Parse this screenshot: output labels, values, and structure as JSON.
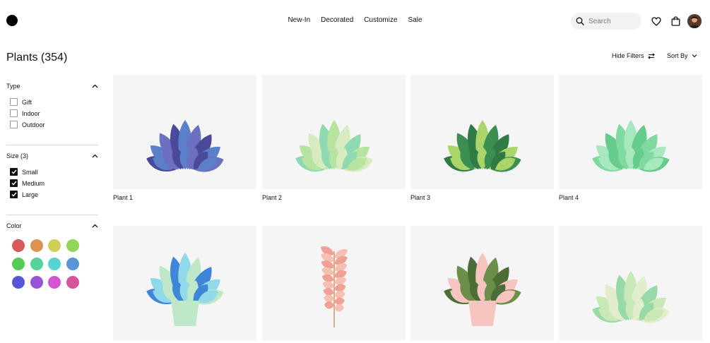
{
  "header": {
    "nav": [
      "New-In",
      "Decorated",
      "Customize",
      "Sale"
    ],
    "search_placeholder": "Search"
  },
  "page": {
    "title": "Plants (354)",
    "hide_filters": "Hide Filters",
    "sort_by": "Sort By"
  },
  "filters": {
    "type": {
      "title": "Type",
      "options": [
        {
          "label": "Gift",
          "checked": false
        },
        {
          "label": "Indoor",
          "checked": false
        },
        {
          "label": "Outdoor",
          "checked": false
        }
      ]
    },
    "size": {
      "title": "Size (3)",
      "options": [
        {
          "label": "Small",
          "checked": true
        },
        {
          "label": "Medium",
          "checked": true
        },
        {
          "label": "Large",
          "checked": true
        }
      ]
    },
    "color": {
      "title": "Color",
      "swatches": [
        "#d65a5a",
        "#d99550",
        "#cfcf58",
        "#8fd65a",
        "#55cc55",
        "#55d49a",
        "#55d4d4",
        "#5a95d6",
        "#5555d6",
        "#9a55d6",
        "#d455d4",
        "#d6559a"
      ]
    }
  },
  "products": [
    {
      "name": "Plant 1",
      "icon": "purple-blue-plant",
      "colors": [
        "#4b4a9a",
        "#5b7fc8",
        "#6d6fbf"
      ]
    },
    {
      "name": "Plant 2",
      "icon": "light-green-plant",
      "colors": [
        "#8fd9b0",
        "#b7e3a0",
        "#d8ebc0"
      ]
    },
    {
      "name": "Plant 3",
      "icon": "monstera-plant",
      "colors": [
        "#2f7a45",
        "#a9d56a",
        "#3c8f52"
      ]
    },
    {
      "name": "Plant 4",
      "icon": "mint-monstera-plant",
      "colors": [
        "#7fd9a0",
        "#a8e8bf",
        "#66cc8c"
      ]
    },
    {
      "name": "",
      "icon": "blue-potted-plant",
      "colors": [
        "#3f86d8",
        "#8fd9e8",
        "#bfe8c8"
      ]
    },
    {
      "name": "",
      "icon": "pink-stem-plant",
      "colors": [
        "#f0a193",
        "#d8b08a",
        "#f5bfb3"
      ]
    },
    {
      "name": "",
      "icon": "olive-potted-plant",
      "colors": [
        "#4c6d35",
        "#f7c4c0",
        "#6b8f48"
      ]
    },
    {
      "name": "",
      "icon": "pale-green-plant",
      "colors": [
        "#98d9a8",
        "#c9e8b8",
        "#e2edcc"
      ]
    }
  ]
}
